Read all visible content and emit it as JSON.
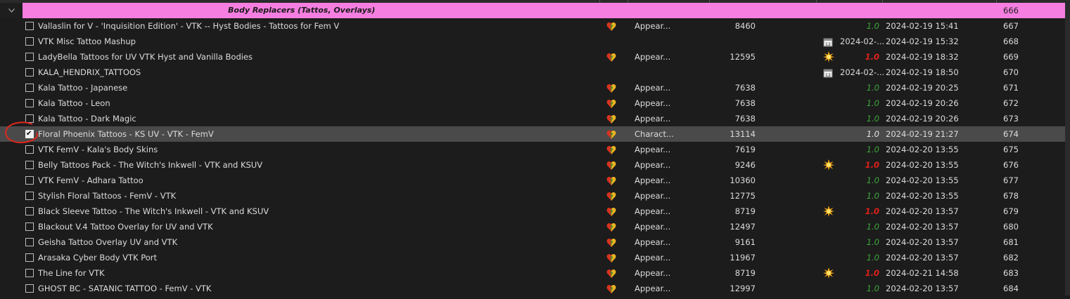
{
  "group": {
    "title": "Body Replacers (Tattos, Overlays)",
    "priority": "666",
    "color": "#f67ee0"
  },
  "icons": {
    "collapse": "chevron-down-icon",
    "flag": "heart-question-flag-icon",
    "calendar": "calendar-icon",
    "conflict": "conflict-burst-icon"
  },
  "colors": {
    "version_ok": "#3ea63a",
    "version_outdated": "#e0201a",
    "selected_row": "#4a4a4a",
    "annotation": "#e0261e"
  },
  "rows": [
    {
      "name": "Vallaslin for V - 'Inquisition Edition' - VTK -- Hyst Bodies - Tattoos for Fem V",
      "checked": false,
      "flag": true,
      "category": "Appear...",
      "mod_id": "8460",
      "extra": "",
      "version": "1.0",
      "version_state": "green",
      "date": "2024-02-19 15:41",
      "priority": "667"
    },
    {
      "name": "VTK Misc Tattoo Mashup",
      "checked": false,
      "flag": false,
      "category": "",
      "mod_id": "",
      "extra": "calendar",
      "extra_text": "2024-02-...",
      "version": "",
      "version_state": "",
      "date": "2024-02-19 15:32",
      "priority": "668"
    },
    {
      "name": "LadyBella Tattoos for UV VTK Hyst and Vanilla Bodies",
      "checked": false,
      "flag": true,
      "category": "Appear...",
      "mod_id": "12595",
      "extra": "burst",
      "version": "1.0",
      "version_state": "red",
      "date": "2024-02-19 18:32",
      "priority": "669"
    },
    {
      "name": "KALA_HENDRIX_TATTOOS",
      "checked": false,
      "flag": false,
      "category": "",
      "mod_id": "",
      "extra": "calendar",
      "extra_text": "2024-02-...",
      "version": "",
      "version_state": "",
      "date": "2024-02-19 18:50",
      "priority": "670"
    },
    {
      "name": "Kala Tattoo - Japanese",
      "checked": false,
      "flag": true,
      "category": "Appear...",
      "mod_id": "7638",
      "extra": "",
      "version": "1.0",
      "version_state": "green",
      "date": "2024-02-19 20:25",
      "priority": "671"
    },
    {
      "name": "Kala Tattoo - Leon",
      "checked": false,
      "flag": true,
      "category": "Appear...",
      "mod_id": "7638",
      "extra": "",
      "version": "1.0",
      "version_state": "green",
      "date": "2024-02-19 20:26",
      "priority": "672"
    },
    {
      "name": "Kala Tattoo - Dark Magic",
      "checked": false,
      "flag": true,
      "category": "Appear...",
      "mod_id": "7638",
      "extra": "",
      "version": "1.0",
      "version_state": "green",
      "date": "2024-02-19 20:26",
      "priority": "673"
    },
    {
      "name": "Floral Phoenix Tattoos - KS UV - VTK - FemV",
      "checked": true,
      "selected": true,
      "flag": true,
      "category": "Charact...",
      "mod_id": "13114",
      "extra": "",
      "version": "1.0",
      "version_state": "white",
      "date": "2024-02-19 21:27",
      "priority": "674"
    },
    {
      "name": "VTK FemV - Kala's Body Skins",
      "checked": false,
      "flag": true,
      "category": "Appear...",
      "mod_id": "7619",
      "extra": "",
      "version": "1.0",
      "version_state": "green",
      "date": "2024-02-20 13:55",
      "priority": "675"
    },
    {
      "name": "Belly Tattoos Pack - The Witch's Inkwell - VTK and KSUV",
      "checked": false,
      "flag": true,
      "category": "Appear...",
      "mod_id": "9246",
      "extra": "burst",
      "version": "1.0",
      "version_state": "red",
      "date": "2024-02-20 13:55",
      "priority": "676"
    },
    {
      "name": "VTK FemV - Adhara Tattoo",
      "checked": false,
      "flag": true,
      "category": "Appear...",
      "mod_id": "10360",
      "extra": "",
      "version": "1.0",
      "version_state": "green",
      "date": "2024-02-20 13:55",
      "priority": "677"
    },
    {
      "name": "Stylish Floral Tattoos - FemV - VTK",
      "checked": false,
      "flag": true,
      "category": "Appear...",
      "mod_id": "12775",
      "extra": "",
      "version": "1.0",
      "version_state": "green",
      "date": "2024-02-20 13:55",
      "priority": "678"
    },
    {
      "name": "Black Sleeve Tattoo - The Witch's Inkwell - VTK and KSUV",
      "checked": false,
      "flag": true,
      "category": "Appear...",
      "mod_id": "8719",
      "extra": "burst",
      "version": "1.0",
      "version_state": "red",
      "date": "2024-02-20 13:57",
      "priority": "679"
    },
    {
      "name": "Blackout V.4 Tattoo Overlay for UV and VTK",
      "checked": false,
      "flag": true,
      "category": "Appear...",
      "mod_id": "12497",
      "extra": "",
      "version": "1.0",
      "version_state": "green",
      "date": "2024-02-20 13:57",
      "priority": "680"
    },
    {
      "name": "Geisha Tattoo Overlay UV and VTK",
      "checked": false,
      "flag": true,
      "category": "Appear...",
      "mod_id": "9161",
      "extra": "",
      "version": "1.0",
      "version_state": "green",
      "date": "2024-02-20 13:57",
      "priority": "681"
    },
    {
      "name": "Arasaka Cyber Body VTK Port",
      "checked": false,
      "flag": true,
      "category": "Appear...",
      "mod_id": "11967",
      "extra": "",
      "version": "1.0",
      "version_state": "green",
      "date": "2024-02-20 13:57",
      "priority": "682"
    },
    {
      "name": "The Line for VTK",
      "checked": false,
      "flag": true,
      "category": "Appear...",
      "mod_id": "8719",
      "extra": "burst",
      "version": "1.0",
      "version_state": "red",
      "date": "2024-02-21 14:58",
      "priority": "683"
    },
    {
      "name": "GHOST BC - SATANIC TATTOO - FemV - VTK",
      "checked": false,
      "flag": true,
      "category": "Appear...",
      "mod_id": "12997",
      "extra": "",
      "version": "1.0",
      "version_state": "green",
      "date": "2024-02-20 13:57",
      "priority": "684"
    }
  ]
}
